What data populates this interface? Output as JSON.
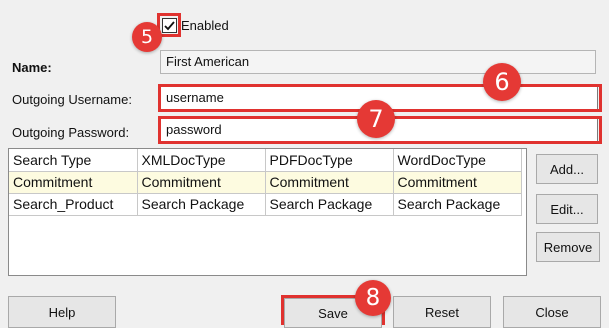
{
  "form": {
    "enabled_label": "Enabled",
    "enabled_checked": true,
    "name_label": "Name:",
    "name_value": "First American",
    "username_label": "Outgoing Username:",
    "username_value": "username",
    "password_label": "Outgoing Password:",
    "password_value": "password"
  },
  "grid": {
    "columns": [
      "Search Type",
      "XMLDocType",
      "PDFDocType",
      "WordDocType"
    ],
    "rows": [
      [
        "Commitment",
        "Commitment",
        "Commitment",
        "Commitment"
      ],
      [
        "Search_Product",
        "Search Package",
        "Search Package",
        "Search Package"
      ]
    ]
  },
  "side_buttons": {
    "add": "Add...",
    "edit": "Edit...",
    "remove": "Remove"
  },
  "bottom_buttons": {
    "help": "Help",
    "save": "Save",
    "reset": "Reset",
    "close": "Close"
  },
  "annotations": {
    "step_5": "5",
    "step_6": "6",
    "step_7": "7",
    "step_8": "8",
    "color": "#e53935"
  }
}
